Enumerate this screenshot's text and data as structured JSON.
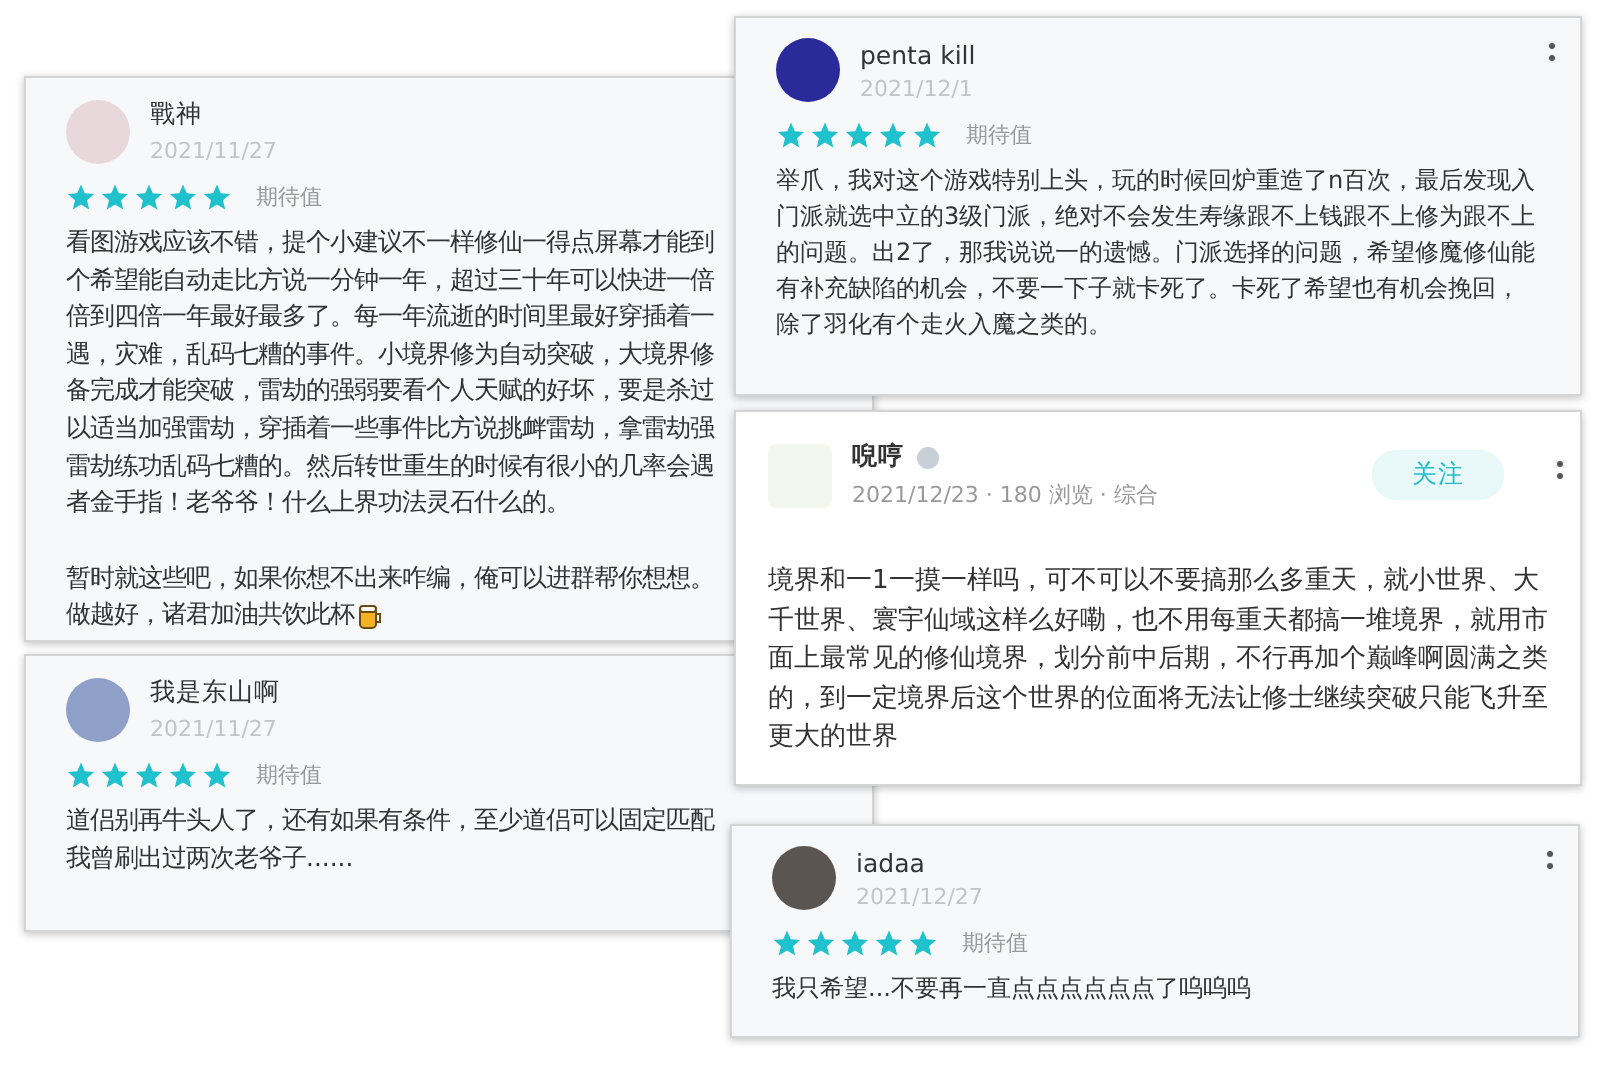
{
  "reviews": [
    {
      "kind": "rating",
      "user": "戰神",
      "date": "2021/11/27",
      "stars": 5,
      "rating_label": "期待值",
      "more_menu": false,
      "paragraphs": [
        [
          "看图游戏应该不错，提个小建议不一样修仙一得点屏幕才能到",
          "个希望能自动走比方说一分钟一年，超过三十年可以快进一倍",
          "倍到四倍一年最好最多了。每一年流逝的时间里最好穿插着一",
          "遇，灾难，乱码七糟的事件。小境界修为自动突破，大境界修",
          "备完成才能突破，雷劫的强弱要看个人天赋的好坏，要是杀过",
          "以适当加强雷劫，穿插着一些事件比方说挑衅雷劫，拿雷劫强",
          "雷劫练功乱码七糟的。然后转世重生的时候有很小的几率会遇",
          "者金手指！老爷爷！什么上界功法灵石什么的。"
        ],
        [
          "暂时就这些吧，如果你想不出来咋编，俺可以进群帮你想想。",
          "做越好，诸君加油共饮此杯"
        ]
      ],
      "ends_with_emoji": true
    },
    {
      "kind": "rating",
      "user": "我是东山啊",
      "date": "2021/11/27",
      "stars": 5,
      "rating_label": "期待值",
      "more_menu": false,
      "paragraphs": [
        [
          "道侣别再牛头人了，还有如果有条件，至少道侣可以固定匹配",
          "我曾刷出过两次老爷子......"
        ]
      ],
      "ends_with_emoji": false
    },
    {
      "kind": "rating",
      "user": "penta kill",
      "date": "2021/12/1",
      "stars": 5,
      "rating_label": "期待值",
      "more_menu": true,
      "paragraphs": [
        [
          "举爪，我对这个游戏特别上头，玩的时候回炉重造了n百次，最后发现入门派就选中立的3级门派，绝对不会发生寿缘跟不上钱跟不上修为跟不上的问题。出2了，那我说说一的遗憾。门派选择的问题，希望修魔修仙能有补充缺陷的机会，不要一下子就卡死了。卡死了希望也有机会挽回，除了羽化有个走火入魔之类的。"
        ]
      ],
      "ends_with_emoji": false
    },
    {
      "kind": "post",
      "user": "唲哼",
      "verified": true,
      "meta": "2021/12/23 · 180 浏览 · 综合",
      "follow_label": "关注",
      "more_menu": true,
      "paragraphs": [
        [
          "境界和一1一摸一样吗，可不可以不要搞那么多重天，就小世界、大千世界、寰宇仙域这样么好嘞，也不用每重天都搞一堆境界，就用市面上最常见的修仙境界，划分前中后期，不行再加个巅峰啊圆满之类的，到一定境界后这个世界的位面将无法让修士继续突破只能飞升至更大的世界"
        ]
      ]
    },
    {
      "kind": "rating",
      "user": "iadaa",
      "date": "2021/12/27",
      "stars": 5,
      "rating_label": "期待值",
      "more_menu": true,
      "paragraphs": [
        [
          "我只希望...不要再一直点点点点点点了呜呜呜"
        ]
      ],
      "ends_with_emoji": false
    }
  ]
}
